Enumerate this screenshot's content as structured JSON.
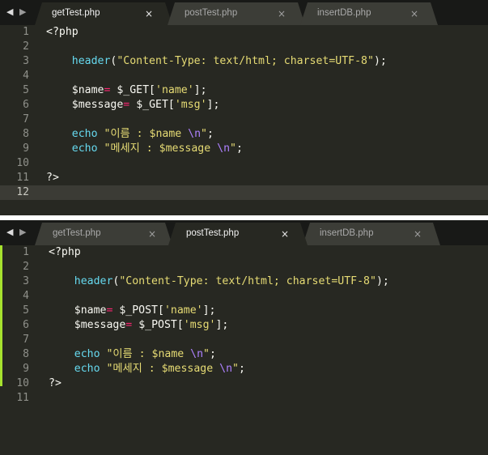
{
  "top_pane": {
    "nav": {
      "back": "◀",
      "forward": "▶"
    },
    "tabs": [
      {
        "label": "getTest.php",
        "active": true
      },
      {
        "label": "postTest.php",
        "active": false
      },
      {
        "label": "insertDB.php",
        "active": false
      }
    ],
    "close_glyph": "×",
    "line_numbers": [
      "1",
      "2",
      "3",
      "4",
      "5",
      "6",
      "7",
      "8",
      "9",
      "10",
      "11",
      "12"
    ],
    "code": {
      "l1": "<?php",
      "l3_fn": "header",
      "l3_open": "(",
      "l3_str": "\"Content-Type: text/html; charset=UTF-8\"",
      "l3_close": ");",
      "l5_var": "$name",
      "l5_op": "=",
      "l5_rest": " $_GET[",
      "l5_key": "'name'",
      "l5_end": "];",
      "l6_var": "$message",
      "l6_op": "=",
      "l6_rest": " $_GET[",
      "l6_key": "'msg'",
      "l6_end": "];",
      "l8_echo": "echo",
      "l8_str1": " \"이름 : ",
      "l8_var": "$name",
      "l8_sp": " ",
      "l8_esc": "\\n",
      "l8_str2": "\"",
      "l8_end": ";",
      "l9_echo": "echo",
      "l9_str1": " \"메세지 : ",
      "l9_var": "$message",
      "l9_sp": " ",
      "l9_esc": "\\n",
      "l9_str2": "\"",
      "l9_end": ";",
      "l11": "?>"
    }
  },
  "bottom_pane": {
    "nav": {
      "back": "◀",
      "forward": "▶"
    },
    "tabs": [
      {
        "label": "getTest.php",
        "active": false
      },
      {
        "label": "postTest.php",
        "active": true
      },
      {
        "label": "insertDB.php",
        "active": false
      }
    ],
    "close_glyph": "×",
    "line_numbers": [
      "1",
      "2",
      "3",
      "4",
      "5",
      "6",
      "7",
      "8",
      "9",
      "10",
      "11"
    ],
    "code": {
      "l1": "<?php",
      "l3_fn": "header",
      "l3_open": "(",
      "l3_str": "\"Content-Type: text/html; charset=UTF-8\"",
      "l3_close": ");",
      "l5_var": "$name",
      "l5_op": "=",
      "l5_rest": " $_POST[",
      "l5_key": "'name'",
      "l5_end": "];",
      "l6_var": "$message",
      "l6_op": "=",
      "l6_rest": " $_POST[",
      "l6_key": "'msg'",
      "l6_end": "];",
      "l8_echo": "echo",
      "l8_str1": " \"이름 : ",
      "l8_var": "$name",
      "l8_sp": " ",
      "l8_esc": "\\n",
      "l8_str2": "\"",
      "l8_end": ";",
      "l9_echo": "echo",
      "l9_str1": " \"메세지 : ",
      "l9_var": "$message",
      "l9_sp": " ",
      "l9_esc": "\\n",
      "l9_str2": "\"",
      "l9_end": ";",
      "l10": "?>"
    }
  },
  "colors": {
    "editor_bg": "#272822",
    "tabbar_bg": "#181917",
    "active_tab": "#272822",
    "inactive_tab": "#3c3d37",
    "keyword": "#66d9ef",
    "string": "#e6db74",
    "operator": "#f92672",
    "escape": "#ae81ff",
    "modified_marker": "#a6e22e"
  }
}
